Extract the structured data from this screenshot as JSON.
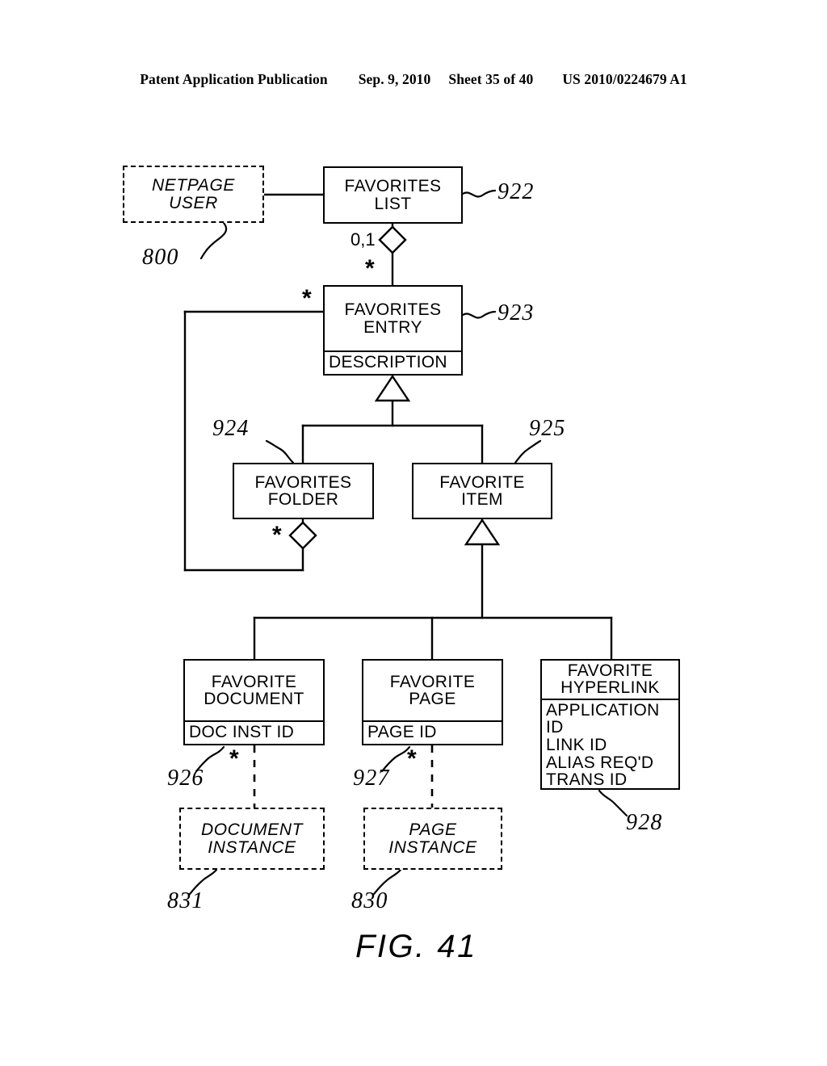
{
  "header": {
    "publication": "Patent Application Publication",
    "date": "Sep. 9, 2010",
    "sheet": "Sheet 35 of 40",
    "number": "US 2010/0224679 A1"
  },
  "figure": {
    "caption": "FIG. 41"
  },
  "classes": {
    "netpage_user": {
      "name": "NETPAGE\nUSER",
      "attrs": "",
      "ref": "800",
      "style": "dashed"
    },
    "favorites_list": {
      "name": "FAVORITES\nLIST",
      "attrs": "",
      "ref": "922",
      "style": "solid"
    },
    "favorites_entry": {
      "name": "FAVORITES\nENTRY",
      "attrs": "DESCRIPTION",
      "ref": "923",
      "style": "solid"
    },
    "favorites_folder": {
      "name": "FAVORITES\nFOLDER",
      "attrs": "",
      "ref": "924",
      "style": "solid"
    },
    "favorite_item": {
      "name": "FAVORITE\nITEM",
      "attrs": "",
      "ref": "925",
      "style": "solid"
    },
    "favorite_document": {
      "name": "FAVORITE\nDOCUMENT",
      "attrs": "DOC INST ID",
      "ref": "926",
      "style": "solid"
    },
    "favorite_page": {
      "name": "FAVORITE\nPAGE",
      "attrs": "PAGE ID",
      "ref": "927",
      "style": "solid"
    },
    "favorite_hyperlink": {
      "name": "FAVORITE\nHYPERLINK",
      "attrs": "APPLICATION ID\nLINK ID\nALIAS REQ'D\nTRANS ID",
      "ref": "928",
      "style": "solid"
    },
    "document_instance": {
      "name": "DOCUMENT\nINSTANCE",
      "attrs": "",
      "ref": "831",
      "style": "dashed"
    },
    "page_instance": {
      "name": "PAGE\nINSTANCE",
      "attrs": "",
      "ref": "830",
      "style": "dashed"
    }
  },
  "multiplicities": {
    "list_to_entry_near_list": "0,1",
    "list_to_entry_near_entry": "*",
    "entry_from_folder": "*",
    "folder_aggregation": "*",
    "document_to_instance": "*",
    "page_to_instance": "*"
  }
}
